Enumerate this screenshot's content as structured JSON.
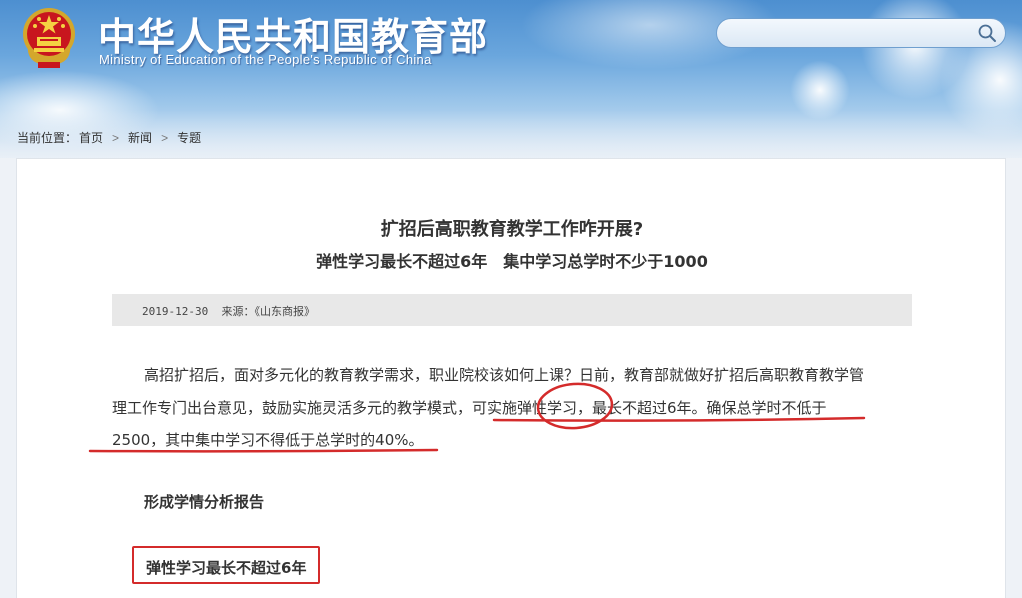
{
  "header": {
    "site_title": "中华人民共和国教育部",
    "site_subtitle": "Ministry of Education of the People's Republic of China",
    "search": {
      "placeholder": "",
      "value": ""
    }
  },
  "breadcrumb": {
    "label": "当前位置：",
    "items": [
      "首页",
      "新闻",
      "专题"
    ],
    "separator": ">"
  },
  "article": {
    "title": "扩招后高职教育教学工作咋开展?",
    "subtitle": "弹性学习最长不超过6年　集中学习总学时不少于1000",
    "date": "2019-12-30",
    "source": "来源：《山东商报》",
    "paragraph_lines": [
      "高招扩招后，面对多元化的教育教学需求，职业院校该如何上课？日前，教育部就做好扩招后高职教育教学管",
      "理工作专门出台意见，鼓励实施灵活多元的教学模式，可实施弹性学习，最长不超过6年。确保总学时不低于",
      "2500，其中集中学习不得低于总学时的40%。"
    ],
    "section_heading": "形成学情分析报告",
    "boxed_heading": "弹性学习最长不超过6年"
  },
  "colors": {
    "annotation_red": "#d42b2b",
    "header_blue": "#4d8fd0"
  },
  "icons": [
    "national-emblem-icon",
    "search-icon",
    "chevron-right-icon"
  ]
}
